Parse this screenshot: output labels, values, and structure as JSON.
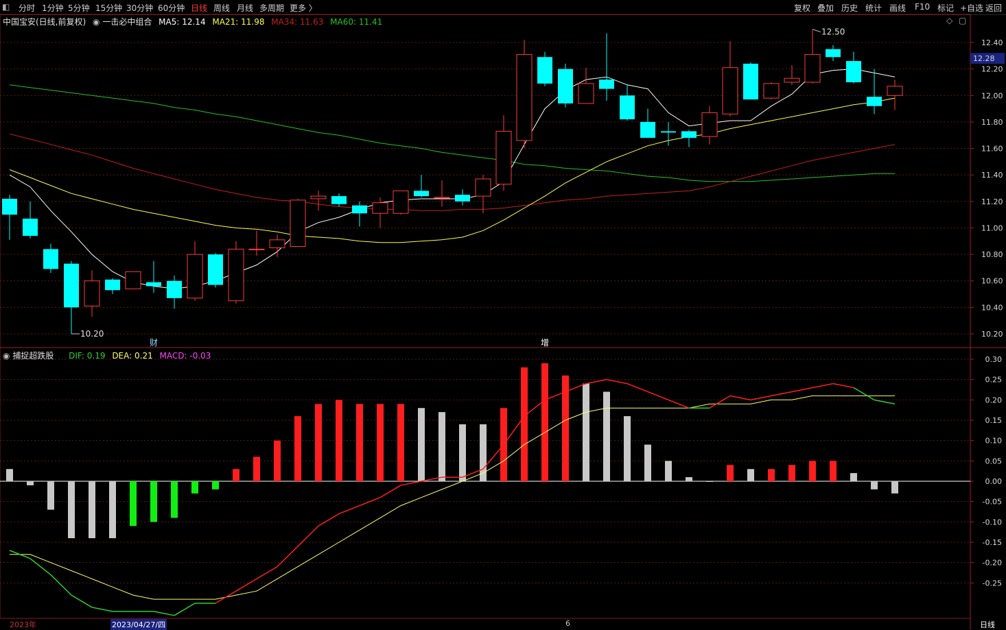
{
  "toolbar": {
    "left_items": [
      {
        "label": "分时",
        "x": 27
      },
      {
        "label": "1分钟",
        "x": 61
      },
      {
        "label": "5分钟",
        "x": 99
      },
      {
        "label": "15分钟",
        "x": 139
      },
      {
        "label": "30分钟",
        "x": 184
      },
      {
        "label": "60分钟",
        "x": 230
      },
      {
        "label": "日线",
        "x": 278,
        "active": true
      },
      {
        "label": "周线",
        "x": 311
      },
      {
        "label": "月线",
        "x": 345
      },
      {
        "label": "多周期",
        "x": 378
      },
      {
        "label": "更多 〉",
        "x": 422
      }
    ],
    "right_items": [
      {
        "label": "复权",
        "x": 1157
      },
      {
        "label": "叠加",
        "x": 1191
      },
      {
        "label": "历史",
        "x": 1226
      },
      {
        "label": "统计",
        "x": 1261
      },
      {
        "label": "画线",
        "x": 1296
      },
      {
        "label": "F10",
        "x": 1333
      },
      {
        "label": "标记",
        "x": 1366
      },
      {
        "label": "+自选",
        "x": 1399
      },
      {
        "label": "返回",
        "x": 1436
      }
    ]
  },
  "main_info": {
    "stock": "中国宝安(日线,前复权)",
    "indicator": "一击必中组合",
    "ma5": "MA5: 12.14",
    "ma21": "MA21: 11.98",
    "ma34": "MA34: 11.63",
    "ma60": "MA60: 11.41"
  },
  "sub_info": {
    "name": "捕捉超跌股",
    "dif": "DIF: 0.19",
    "dea": "DEA: 0.21",
    "macd": "MACD: -0.03"
  },
  "markers": {
    "low_label": "10.20",
    "high_label": "12.50",
    "cai": "财",
    "zeng": "增",
    "current_price": "12.28"
  },
  "datebar": {
    "year": "2023年",
    "date": "2023/04/27/四",
    "month": "6",
    "period": "日线"
  },
  "colors": {
    "up": "#ff3b3b",
    "down": "#00ffff",
    "ma5": "#ffffff",
    "ma21": "#ffff44",
    "ma34": "#c81e1e",
    "ma60": "#22c322",
    "dif_up": "#ff1e1e",
    "dif_down": "#2ed02e",
    "dea": "#ffff66",
    "macd_up": "#ff1e1e",
    "macd_down": "#11ee11",
    "macd_fade": "#c8c8c8",
    "grid": "#5a1a1a"
  },
  "chart_data": [
    {
      "type": "candlestick",
      "y_ticks": [
        12.4,
        12.2,
        12.0,
        11.8,
        11.6,
        11.4,
        11.2,
        11.0,
        10.8,
        10.6,
        10.4,
        10.2
      ],
      "ylim": [
        10.15,
        12.55
      ],
      "candles": [
        {
          "o": 11.22,
          "h": 11.25,
          "l": 10.91,
          "c": 11.1
        },
        {
          "o": 11.07,
          "h": 11.2,
          "l": 10.92,
          "c": 10.94
        },
        {
          "o": 10.84,
          "h": 10.88,
          "l": 10.66,
          "c": 10.69
        },
        {
          "o": 10.73,
          "h": 10.75,
          "l": 10.2,
          "c": 10.4
        },
        {
          "o": 10.41,
          "h": 10.68,
          "l": 10.33,
          "c": 10.6
        },
        {
          "o": 10.61,
          "h": 10.62,
          "l": 10.5,
          "c": 10.53
        },
        {
          "o": 10.54,
          "h": 10.67,
          "l": 10.54,
          "c": 10.67
        },
        {
          "o": 10.59,
          "h": 10.75,
          "l": 10.51,
          "c": 10.56
        },
        {
          "o": 10.6,
          "h": 10.64,
          "l": 10.39,
          "c": 10.47
        },
        {
          "o": 10.47,
          "h": 10.9,
          "l": 10.45,
          "c": 10.8
        },
        {
          "o": 10.8,
          "h": 10.81,
          "l": 10.55,
          "c": 10.57
        },
        {
          "o": 10.45,
          "h": 10.9,
          "l": 10.43,
          "c": 10.84
        },
        {
          "o": 10.84,
          "h": 10.98,
          "l": 10.79,
          "c": 10.84
        },
        {
          "o": 10.85,
          "h": 10.95,
          "l": 10.78,
          "c": 10.91
        },
        {
          "o": 10.86,
          "h": 11.22,
          "l": 10.86,
          "c": 11.21
        },
        {
          "o": 11.22,
          "h": 11.28,
          "l": 11.13,
          "c": 11.24
        },
        {
          "o": 11.24,
          "h": 11.26,
          "l": 11.16,
          "c": 11.18
        },
        {
          "o": 11.17,
          "h": 11.2,
          "l": 11.01,
          "c": 11.11
        },
        {
          "o": 11.11,
          "h": 11.23,
          "l": 11.0,
          "c": 11.19
        },
        {
          "o": 11.11,
          "h": 11.28,
          "l": 11.1,
          "c": 11.28
        },
        {
          "o": 11.28,
          "h": 11.4,
          "l": 11.23,
          "c": 11.24
        },
        {
          "o": 11.23,
          "h": 11.36,
          "l": 11.16,
          "c": 11.23
        },
        {
          "o": 11.25,
          "h": 11.29,
          "l": 11.17,
          "c": 11.2
        },
        {
          "o": 11.24,
          "h": 11.4,
          "l": 11.11,
          "c": 11.37
        },
        {
          "o": 11.33,
          "h": 11.85,
          "l": 11.28,
          "c": 11.73
        },
        {
          "o": 11.66,
          "h": 12.42,
          "l": 11.6,
          "c": 12.31
        },
        {
          "o": 12.29,
          "h": 12.33,
          "l": 12.07,
          "c": 12.09
        },
        {
          "o": 12.2,
          "h": 12.24,
          "l": 11.91,
          "c": 11.94
        },
        {
          "o": 11.94,
          "h": 12.21,
          "l": 11.94,
          "c": 12.09
        },
        {
          "o": 12.12,
          "h": 12.47,
          "l": 11.96,
          "c": 12.05
        },
        {
          "o": 12.0,
          "h": 12.08,
          "l": 11.81,
          "c": 11.82
        },
        {
          "o": 11.8,
          "h": 11.9,
          "l": 11.69,
          "c": 11.68
        },
        {
          "o": 11.73,
          "h": 11.8,
          "l": 11.62,
          "c": 11.72
        },
        {
          "o": 11.73,
          "h": 11.74,
          "l": 11.61,
          "c": 11.68
        },
        {
          "o": 11.69,
          "h": 11.92,
          "l": 11.63,
          "c": 11.87
        },
        {
          "o": 11.86,
          "h": 12.41,
          "l": 11.84,
          "c": 12.21
        },
        {
          "o": 12.24,
          "h": 12.25,
          "l": 11.97,
          "c": 11.97
        },
        {
          "o": 11.98,
          "h": 12.1,
          "l": 11.97,
          "c": 12.09
        },
        {
          "o": 12.1,
          "h": 12.23,
          "l": 12.08,
          "c": 12.13
        },
        {
          "o": 12.1,
          "h": 12.5,
          "l": 12.09,
          "c": 12.31
        },
        {
          "o": 12.35,
          "h": 12.38,
          "l": 12.26,
          "c": 12.29
        },
        {
          "o": 12.26,
          "h": 12.33,
          "l": 12.09,
          "c": 12.1
        },
        {
          "o": 11.99,
          "h": 12.2,
          "l": 11.86,
          "c": 11.92
        },
        {
          "o": 12.0,
          "h": 12.12,
          "l": 11.89,
          "c": 12.07
        }
      ],
      "ma5": [
        11.4,
        11.31,
        11.13,
        10.97,
        10.8,
        10.67,
        10.59,
        10.56,
        10.54,
        10.56,
        10.6,
        10.66,
        10.72,
        10.82,
        10.97,
        11.04,
        11.08,
        11.14,
        11.19,
        11.21,
        11.22,
        11.22,
        11.22,
        11.25,
        11.35,
        11.63,
        11.9,
        12.04,
        12.12,
        12.14,
        12.08,
        12.05,
        11.87,
        11.77,
        11.79,
        11.81,
        11.81,
        11.92,
        12.01,
        12.16,
        12.19,
        12.2,
        12.17,
        12.14
      ],
      "ma21": [
        11.44,
        11.38,
        11.32,
        11.26,
        11.22,
        11.18,
        11.14,
        11.11,
        11.08,
        11.05,
        11.02,
        11.0,
        10.99,
        10.97,
        10.94,
        10.93,
        10.92,
        10.9,
        10.89,
        10.89,
        10.9,
        10.91,
        10.93,
        10.98,
        11.06,
        11.15,
        11.24,
        11.34,
        11.42,
        11.5,
        11.56,
        11.62,
        11.66,
        11.69,
        11.71,
        11.75,
        11.78,
        11.81,
        11.84,
        11.87,
        11.9,
        11.93,
        11.95,
        11.98
      ],
      "ma34": [
        11.71,
        11.67,
        11.63,
        11.59,
        11.55,
        11.5,
        11.45,
        11.41,
        11.37,
        11.33,
        11.29,
        11.26,
        11.23,
        11.21,
        11.2,
        11.18,
        11.16,
        11.15,
        11.14,
        11.14,
        11.13,
        11.13,
        11.14,
        11.14,
        11.15,
        11.17,
        11.19,
        11.21,
        11.22,
        11.24,
        11.25,
        11.26,
        11.27,
        11.28,
        11.31,
        11.35,
        11.39,
        11.43,
        11.47,
        11.51,
        11.54,
        11.57,
        11.6,
        11.63
      ],
      "ma60": [
        12.08,
        12.06,
        12.04,
        12.02,
        12.0,
        11.98,
        11.96,
        11.94,
        11.91,
        11.89,
        11.86,
        11.84,
        11.81,
        11.78,
        11.75,
        11.72,
        11.7,
        11.67,
        11.64,
        11.62,
        11.6,
        11.57,
        11.55,
        11.53,
        11.51,
        11.48,
        11.47,
        11.45,
        11.44,
        11.43,
        11.41,
        11.39,
        11.38,
        11.36,
        11.35,
        11.35,
        11.35,
        11.36,
        11.37,
        11.38,
        11.39,
        11.4,
        11.41,
        11.41
      ]
    },
    {
      "type": "macd",
      "y_ticks": [
        0.3,
        0.25,
        0.2,
        0.15,
        0.1,
        0.05,
        0.0,
        -0.05,
        -0.1,
        -0.15,
        -0.2,
        -0.25
      ],
      "ylim": [
        -0.3,
        0.31
      ],
      "dif": [
        -0.17,
        -0.19,
        -0.23,
        -0.28,
        -0.31,
        -0.32,
        -0.32,
        -0.32,
        -0.33,
        -0.3,
        -0.3,
        -0.27,
        -0.24,
        -0.21,
        -0.16,
        -0.11,
        -0.08,
        -0.06,
        -0.04,
        -0.01,
        0.0,
        0.01,
        0.01,
        0.03,
        0.09,
        0.16,
        0.2,
        0.22,
        0.24,
        0.25,
        0.24,
        0.22,
        0.2,
        0.18,
        0.18,
        0.21,
        0.2,
        0.21,
        0.22,
        0.23,
        0.24,
        0.23,
        0.2,
        0.19
      ],
      "dea": [
        -0.18,
        -0.18,
        -0.2,
        -0.22,
        -0.24,
        -0.26,
        -0.28,
        -0.29,
        -0.29,
        -0.29,
        -0.29,
        -0.28,
        -0.27,
        -0.24,
        -0.21,
        -0.18,
        -0.15,
        -0.12,
        -0.09,
        -0.06,
        -0.04,
        -0.02,
        0.0,
        0.02,
        0.05,
        0.09,
        0.12,
        0.15,
        0.17,
        0.18,
        0.18,
        0.18,
        0.18,
        0.18,
        0.19,
        0.19,
        0.19,
        0.2,
        0.2,
        0.21,
        0.21,
        0.21,
        0.21,
        0.21
      ],
      "macd": [
        0.03,
        -0.01,
        -0.07,
        -0.14,
        -0.14,
        -0.14,
        -0.11,
        -0.1,
        -0.09,
        -0.03,
        -0.02,
        0.03,
        0.06,
        0.1,
        0.16,
        0.19,
        0.2,
        0.19,
        0.19,
        0.19,
        0.18,
        0.17,
        0.14,
        0.14,
        0.18,
        0.28,
        0.29,
        0.26,
        0.24,
        0.22,
        0.16,
        0.09,
        0.05,
        0.01,
        0.0,
        0.04,
        0.03,
        0.03,
        0.04,
        0.05,
        0.05,
        0.02,
        -0.02,
        -0.03
      ],
      "macd_color": [
        "fade",
        "fade",
        "fade",
        "fade",
        "fade",
        "fade",
        "down",
        "down",
        "down",
        "down",
        "down",
        "up",
        "up",
        "up",
        "up",
        "up",
        "up",
        "up",
        "up",
        "up",
        "fade",
        "fade",
        "fade",
        "fade",
        "up",
        "up",
        "up",
        "up",
        "fade",
        "fade",
        "fade",
        "fade",
        "fade",
        "fade",
        "fade",
        "up",
        "fade",
        "up",
        "up",
        "up",
        "up",
        "fade",
        "fade",
        "fade"
      ]
    }
  ]
}
